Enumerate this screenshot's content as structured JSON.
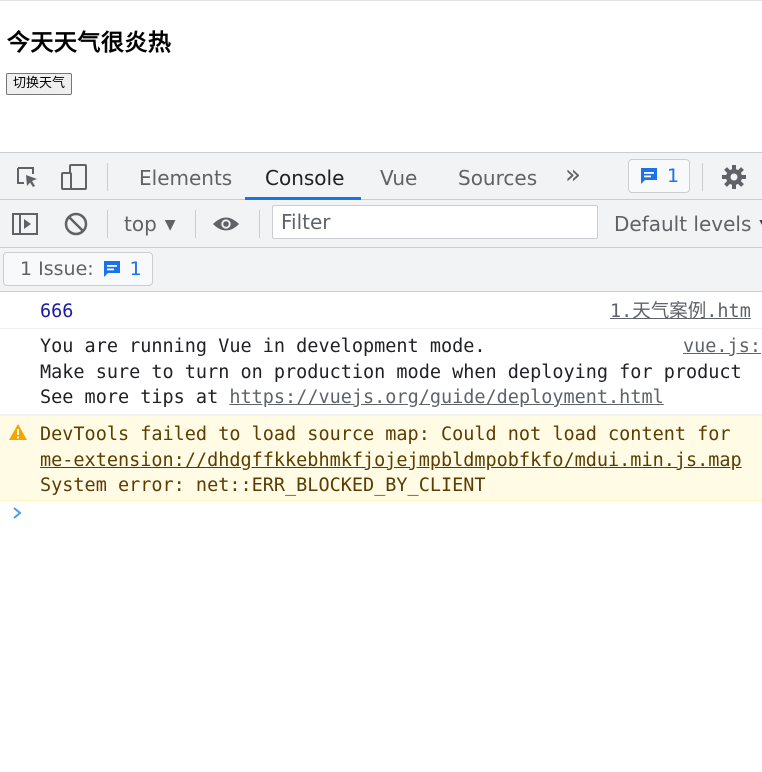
{
  "page": {
    "heading": "今天天气很炎热",
    "button_label": "切换天气"
  },
  "devtools": {
    "tabs": [
      {
        "label": "Elements"
      },
      {
        "label": "Console"
      },
      {
        "label": "Vue"
      },
      {
        "label": "Sources"
      }
    ],
    "more_tabs_glyph": "»",
    "issue_counter": "1",
    "context_selector": "top",
    "filter_placeholder": "Filter",
    "log_levels": "Default levels",
    "issues_label": "1 Issue:",
    "issues_count": "1"
  },
  "console": {
    "messages": [
      {
        "type": "log",
        "lines": [
          "666"
        ],
        "source": "1.天气案例.htm"
      },
      {
        "type": "log",
        "lines": [
          "You are running Vue in development mode.",
          "Make sure to turn on production mode when deploying for product",
          "See more tips at "
        ],
        "link": "https://vuejs.org/guide/deployment.html",
        "source": "vue.js:"
      },
      {
        "type": "warning",
        "lines": [
          "DevTools failed to load source map: Could not load content for",
          "System error: net::ERR_BLOCKED_BY_CLIENT"
        ],
        "link": "me-extension://dhdgffkkebhmkfjojejmpbldmpobfkfo/mdui.min.js.map"
      }
    ]
  },
  "colors": {
    "accent": "#1a73e8",
    "toolbar_bg": "#f1f3f4",
    "warning_bg": "#fffbe5",
    "warning_text": "#5c3c00",
    "number_value": "#1a1aa6"
  }
}
